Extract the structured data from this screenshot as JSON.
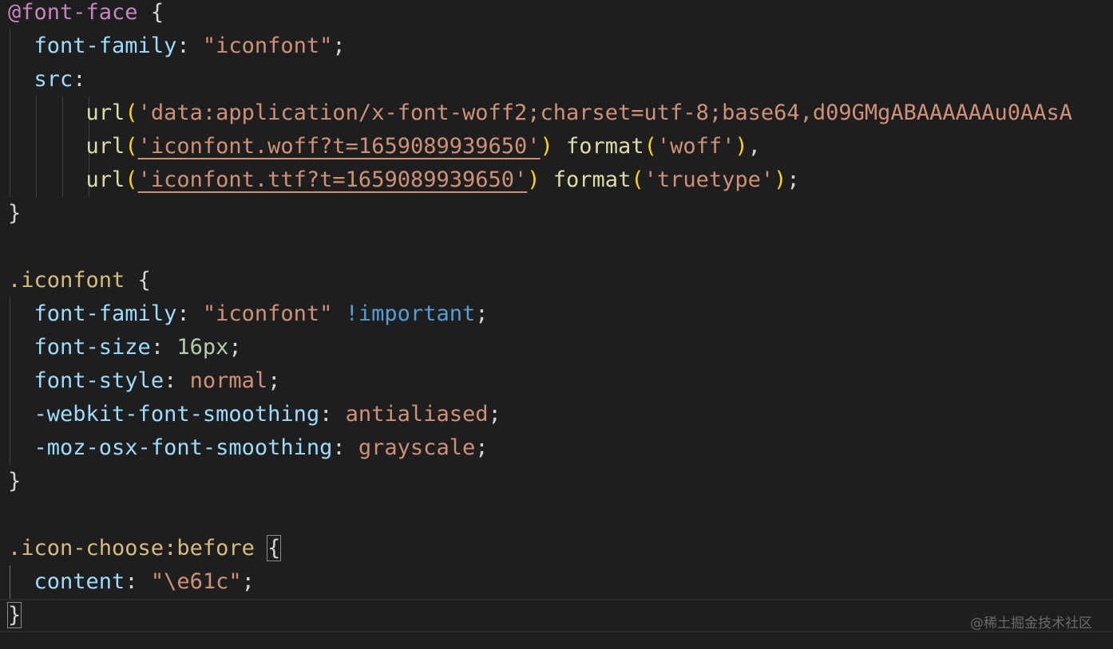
{
  "editor": {
    "theme_colors": {
      "background": "#1e1e1e",
      "at_rule": "#c586c0",
      "selector": "#d7ba7d",
      "property": "#9cdcfe",
      "string": "#ce9178",
      "function": "#dcdcaa",
      "bracket": "#ffd700",
      "number": "#b5cea8",
      "important": "#569cd6"
    },
    "l1": {
      "at": "@font-face",
      "brace": " {"
    },
    "l2": {
      "prop": "font-family",
      "colon": ": ",
      "str": "\"iconfont\"",
      "semi": ";"
    },
    "l3": {
      "prop": "src",
      "colon": ":"
    },
    "l4": {
      "fn": "url",
      "open": "(",
      "str": "'data:application/x-font-woff2;charset=utf-8;base64,d09GMgABAAAAAAu0AAsA"
    },
    "l5": {
      "fn": "url",
      "open": "(",
      "str": "'iconfont.woff?t=1659089939650'",
      "close": ")",
      "fn2": " format",
      "open2": "(",
      "str2": "'woff'",
      "close2": ")",
      "comma": ","
    },
    "l6": {
      "fn": "url",
      "open": "(",
      "str": "'iconfont.ttf?t=1659089939650'",
      "close": ")",
      "fn2": " format",
      "open2": "(",
      "str2": "'truetype'",
      "close2": ")",
      "semi": ";"
    },
    "l7": {
      "brace": "}"
    },
    "l9": {
      "sel": ".iconfont",
      "brace": " {"
    },
    "l10": {
      "prop": "font-family",
      "colon": ": ",
      "str": "\"iconfont\"",
      "imp": " !important",
      "semi": ";"
    },
    "l11": {
      "prop": "font-size",
      "colon": ": ",
      "num": "16px",
      "semi": ";"
    },
    "l12": {
      "prop": "font-style",
      "colon": ": ",
      "str": "normal",
      "semi": ";"
    },
    "l13": {
      "prop": "-webkit-font-smoothing",
      "colon": ": ",
      "str": "antialiased",
      "semi": ";"
    },
    "l14": {
      "prop": "-moz-osx-font-smoothing",
      "colon": ": ",
      "str": "grayscale",
      "semi": ";"
    },
    "l15": {
      "brace": "}"
    },
    "l17": {
      "sel": ".icon-choose:before",
      "space": " ",
      "brace": "{"
    },
    "l18": {
      "prop": "content",
      "colon": ": ",
      "str": "\"\\e61c\"",
      "semi": ";"
    },
    "l19": {
      "brace": "}"
    }
  },
  "watermark": "@稀土掘金技术社区"
}
